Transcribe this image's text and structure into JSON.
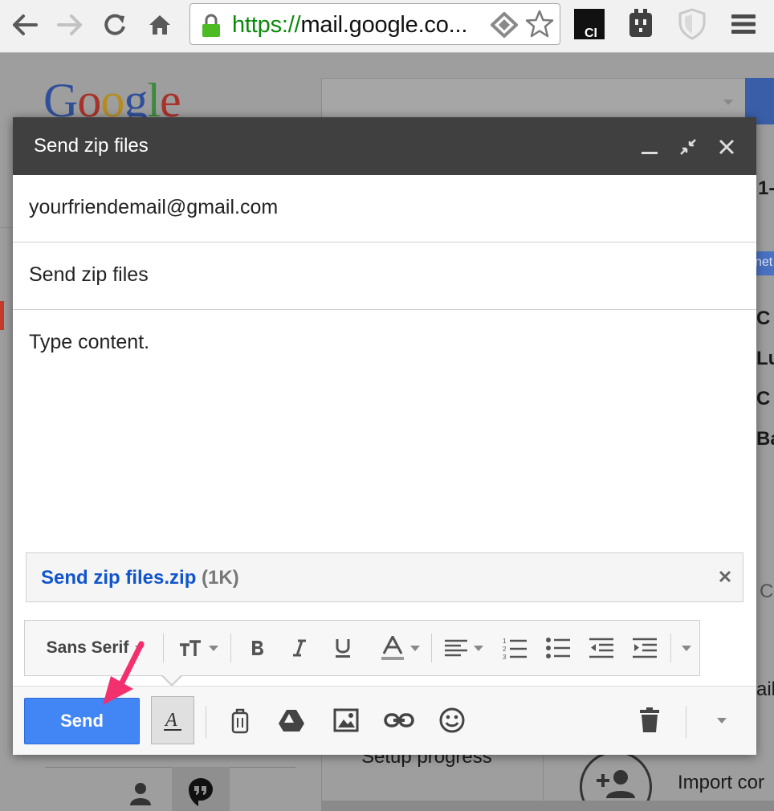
{
  "browser": {
    "url_protocol": "https://",
    "url_rest": "mail.google.co..."
  },
  "background": {
    "logo": "Google",
    "right_snippets": [
      "1-",
      "net",
      "C",
      "Lu",
      "C",
      "Ba",
      "C",
      "ail"
    ],
    "setup_progress": "Setup progress",
    "import_label": "Import cor"
  },
  "compose": {
    "title": "Send zip files",
    "to": "yourfriendemail@gmail.com",
    "subject": "Send zip files",
    "body": "Type content.",
    "attachment": {
      "name": "Send zip files.zip",
      "size": "(1K)"
    },
    "toolbar": {
      "font": "Sans Serif"
    },
    "send_label": "Send"
  },
  "colors": {
    "send_button": "#4285f4",
    "header": "#404040",
    "attachment_link": "#1155cc",
    "annotation_arrow": "#f2306e"
  }
}
